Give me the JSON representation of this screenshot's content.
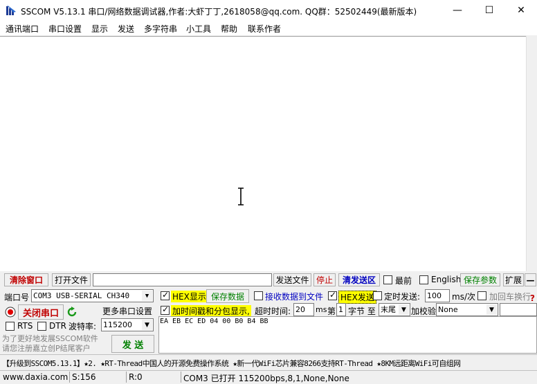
{
  "window": {
    "title": "SSCOM V5.13.1 串口/网络数据调试器,作者:大虾丁丁,2618058@qq.com. QQ群：52502449(最新版本)",
    "minimize": "—",
    "maximize": "☐",
    "close": "✕"
  },
  "menu": [
    "通讯端口",
    "串口设置",
    "显示",
    "发送",
    "多字符串",
    "小工具",
    "帮助",
    "联系作者"
  ],
  "toolbar": {
    "clear_window": "清除窗口",
    "open_file": "打开文件",
    "file_path": "",
    "send_file": "发送文件",
    "stop": "停止",
    "clear_send": "清发送区",
    "topmost": "最前",
    "english": "English",
    "save_params": "保存参数",
    "expand": "扩展",
    "collapse": "—"
  },
  "port": {
    "label": "端口号",
    "value": "COM3 USB-SERIAL CH340",
    "close_port": "关闭串口",
    "more_settings": "更多串口设置",
    "rts": "RTS",
    "dtr": "DTR",
    "baud_label": "波特率:",
    "baud_value": "115200",
    "promo": "为了更好地发展SSCOM软件\n请您注册嘉立创P结尾客户",
    "send": "发 送"
  },
  "options": {
    "hex_display": "HEX显示",
    "save_data": "保存数据",
    "recv_to_file": "接收数据到文件",
    "hex_send": "HEX发送",
    "timed_send": "定时发送:",
    "interval": "100",
    "interval_unit": "ms/次",
    "append_crlf": "加回车换行",
    "timestamp": "加时间戳和分包显示,",
    "timeout_label": "超时时间:",
    "timeout_value": "20",
    "timeout_unit": "ms",
    "nth_label": "第",
    "nth_value": "1",
    "byte_to": "字节 至",
    "end_value": "末尾",
    "checksum_label": "加校验",
    "checksum_value": "None",
    "help": "?"
  },
  "send_data": "EA EB EC ED 04 00 B0 B4 BB",
  "ticker": "【升级到SSCOM5.13.1】★2. ★RT-Thread中国人的开源免费操作系统 ★新一代WiFi芯片兼容8266支持RT-Thread ★8KM远距离WiFi可自组网",
  "status": {
    "website": "www.daxia.com",
    "sent": "S:156",
    "received": "R:0",
    "port_status": "COM3 已打开  115200bps,8,1,None,None"
  }
}
